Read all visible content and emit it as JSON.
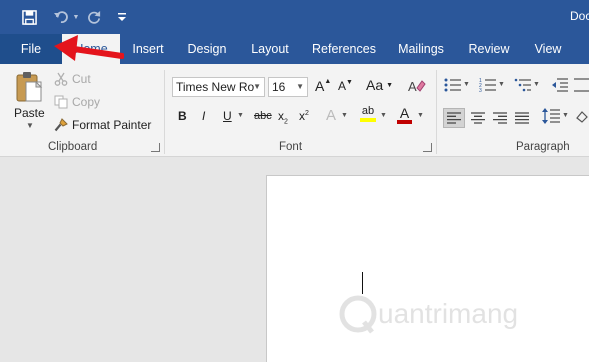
{
  "window": {
    "doc_title": "Doc"
  },
  "quick_access": {
    "icons": [
      "save-icon",
      "undo-icon",
      "redo-icon",
      "customize-icon"
    ]
  },
  "tabs": [
    {
      "id": "file",
      "label": "File"
    },
    {
      "id": "home",
      "label": "Home",
      "active": true
    },
    {
      "id": "insert",
      "label": "Insert"
    },
    {
      "id": "design",
      "label": "Design"
    },
    {
      "id": "layout",
      "label": "Layout"
    },
    {
      "id": "references",
      "label": "References"
    },
    {
      "id": "mailings",
      "label": "Mailings"
    },
    {
      "id": "review",
      "label": "Review"
    },
    {
      "id": "view",
      "label": "View"
    }
  ],
  "clipboard": {
    "label": "Clipboard",
    "paste": "Paste",
    "cut": "Cut",
    "copy": "Copy",
    "format_painter": "Format Painter"
  },
  "font": {
    "label": "Font",
    "family": "Times New Ro",
    "size": "16",
    "grow_label": "A",
    "shrink_label": "A",
    "case_label": "Aa",
    "bold": "B",
    "italic": "I",
    "underline": "U",
    "strike": "abc",
    "subscript": "x",
    "superscript": "x",
    "highlight_label": "ab",
    "font_color_label": "A",
    "highlight_color": "#ffff00",
    "font_color": "#c00000"
  },
  "paragraph": {
    "label": "Paragraph"
  },
  "colors": {
    "brand": "#2b579a",
    "annotation_arrow": "#e4141c"
  },
  "watermark": {
    "text": "uantrimang"
  }
}
